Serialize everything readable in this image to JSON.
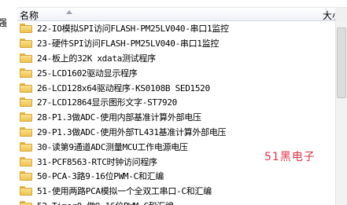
{
  "header": {
    "name_label": "名称",
    "size_label": "大小"
  },
  "left_edge_text": "强",
  "files": [
    {
      "name": "22-IO模拟SPI访问FLASH-PM25LV040-串口1监控",
      "icon": "folder-icon"
    },
    {
      "name": "23-硬件SPI访问FLASH-PM25LV040-串口1监控",
      "icon": "folder-icon"
    },
    {
      "name": "24-板上的32K xdata测试程序",
      "icon": "folder-icon"
    },
    {
      "name": "25-LCD1602驱动显示程序",
      "icon": "folder-icon"
    },
    {
      "name": "26-LCD128x64驱动程序-KS0108B SED1520",
      "icon": "folder-icon"
    },
    {
      "name": "27-LCD12864显示图形文字-ST7920",
      "icon": "folder-icon"
    },
    {
      "name": "28-P1.3做ADC-使用内部基准计算外部电压",
      "icon": "folder-icon"
    },
    {
      "name": "29-P1.3做ADC-使用外部TL431基准计算外部电压",
      "icon": "folder-icon"
    },
    {
      "name": "30-读第9通道ADC测量MCU工作电源电压",
      "icon": "folder-icon"
    },
    {
      "name": "31-PCF8563-RTC时钟访问程序",
      "icon": "folder-icon"
    },
    {
      "name": "50-PCA-3路9-16位PWM-C和汇编",
      "icon": "folder-icon"
    },
    {
      "name": "51-使用两路PCA模拟一个全双工串口-C和汇编",
      "icon": "folder-icon"
    },
    {
      "name": "52-Timer0-做9-16位PWM-C和汇编",
      "icon": "folder-icon"
    }
  ],
  "watermark": "51黑电子"
}
